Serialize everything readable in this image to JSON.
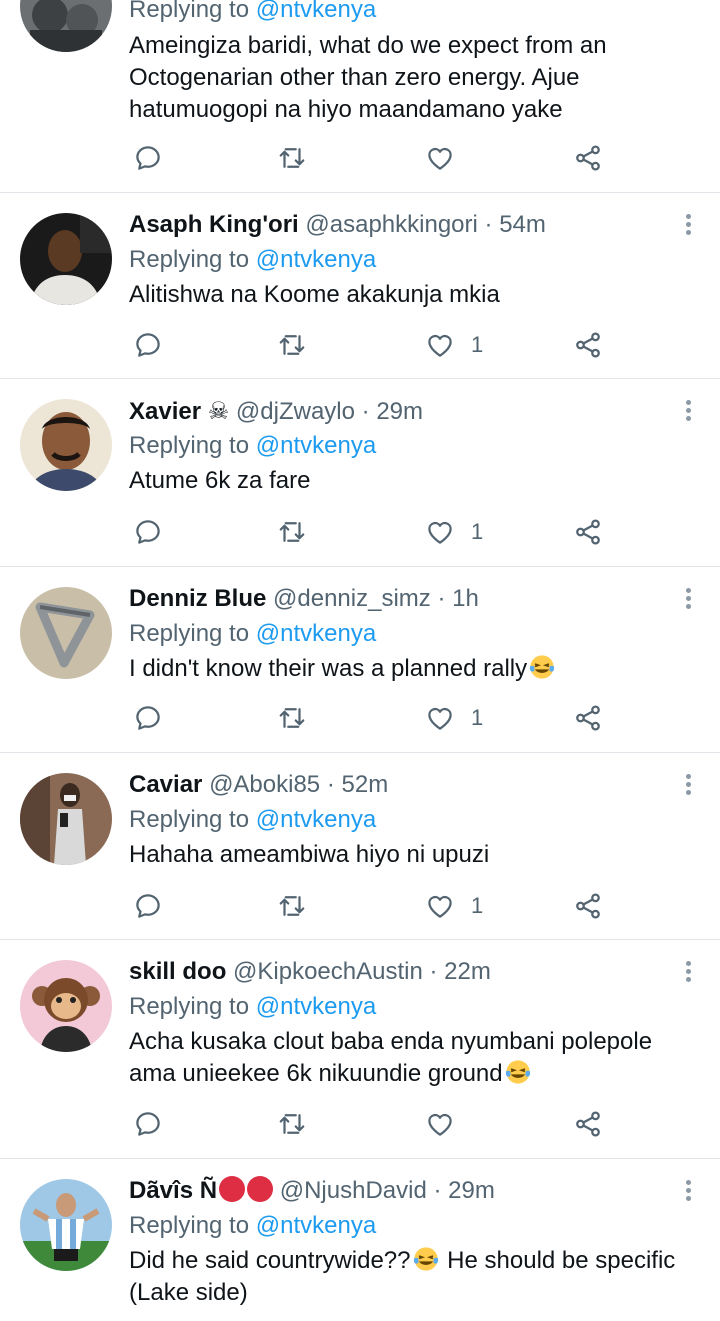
{
  "colors": {
    "accent": "#1d9bf0",
    "muted": "#536471",
    "text": "#0f1419",
    "divider": "#e1e5e9"
  },
  "tweets": [
    {
      "name": "",
      "handle": "",
      "time": "",
      "replying_label": "Replying to",
      "replying_to": "@ntvkenya",
      "lines": [
        "Ameingiza baridi, what do we expect from an",
        "Octogenarian other than zero energy. Ajue",
        "hatumuogopi na hiyo maandamano yake"
      ],
      "likes": ""
    },
    {
      "name": "Asaph King'ori",
      "handle": "@asaphkkingori",
      "time": "54m",
      "replying_label": "Replying to",
      "replying_to": "@ntvkenya",
      "lines": [
        "Alitishwa na Koome akakunja mkia"
      ],
      "likes": "1"
    },
    {
      "name": "Xavier",
      "name_emoji": "☠",
      "handle": "@djZwaylo",
      "time": "29m",
      "replying_label": "Replying to",
      "replying_to": "@ntvkenya",
      "lines": [
        "Atume 6k za fare"
      ],
      "likes": "1"
    },
    {
      "name": "Denniz Blue",
      "handle": "@denniz_simz",
      "time": "1h",
      "replying_label": "Replying to",
      "replying_to": "@ntvkenya",
      "lines": [
        "I didn't know their was a planned rally"
      ],
      "likes": "1"
    },
    {
      "name": "Caviar",
      "handle": "@Aboki85",
      "time": "52m",
      "replying_label": "Replying to",
      "replying_to": "@ntvkenya",
      "lines": [
        "Hahaha ameambiwa hiyo ni upuzi"
      ],
      "likes": "1"
    },
    {
      "name": "skill doo",
      "handle": "@KipkoechAustin",
      "time": "22m",
      "replying_label": "Replying to",
      "replying_to": "@ntvkenya",
      "lines": [
        "Acha kusaka clout baba enda nyumbani polepole",
        "ama unieekee 6k nikuundie ground"
      ],
      "likes": ""
    },
    {
      "name": "Dãvîs Ñ",
      "handle": "@NjushDavid",
      "time": "29m",
      "replying_label": "Replying to",
      "replying_to": "@ntvkenya",
      "lines": [
        "Did he said countrywide??",
        "He should be specific",
        "(Lake side)"
      ],
      "likes": ""
    }
  ],
  "separator": "·"
}
